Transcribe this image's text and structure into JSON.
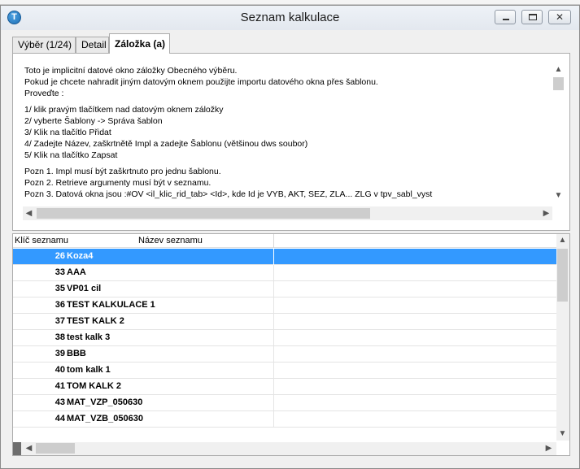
{
  "window": {
    "title": "Seznam kalkulace",
    "icon": "app-t-icon"
  },
  "tabs": [
    {
      "label": "Výběr (1/24)",
      "active": false
    },
    {
      "label": "Detail",
      "active": false
    },
    {
      "label": "Záložka (a)",
      "active": true
    }
  ],
  "info_text": {
    "lines": [
      "Toto je implicitní datové okno záložky Obecného výběru.",
      "Pokud je chcete nahradit jiným datovým oknem použijte importu datového okna přes šablonu.",
      "Proveďte :",
      "1/ klik pravým tlačítkem nad datovým oknem záložky",
      "2/ vyberte Šablony -> Správa šablon",
      "3/ Klik na tlačítlo Přidat",
      "4/ Zadejte Název, zaškrtnětě Impl a zadejte Šablonu (většinou dws soubor)",
      "5/ Klik na tlačítko Zapsat",
      "Pozn 1. Impl musí být zaškrtnuto pro jednu šablonu.",
      "Pozn 2. Retrieve argumenty musí být v seznamu.",
      "Pozn 3. Datová okna jsou :#OV <il_klic_rid_tab>  <Id>,  kde Id je VYB, AKT, SEZ, ZLA... ZLG v  tpv_sabl_vyst"
    ]
  },
  "grid": {
    "columns": [
      "Klíč seznamu",
      "Název seznamu"
    ],
    "rows": [
      {
        "key": "26",
        "name": "Koza4",
        "selected": true
      },
      {
        "key": "33",
        "name": "AAA",
        "selected": false
      },
      {
        "key": "35",
        "name": "VP01 cil",
        "selected": false
      },
      {
        "key": "36",
        "name": "TEST KALKULACE 1",
        "selected": false
      },
      {
        "key": "37",
        "name": "TEST KALK 2",
        "selected": false
      },
      {
        "key": "38",
        "name": "test kalk 3",
        "selected": false
      },
      {
        "key": "39",
        "name": "BBB",
        "selected": false
      },
      {
        "key": "40",
        "name": "tom kalk 1",
        "selected": false
      },
      {
        "key": "41",
        "name": "TOM KALK 2",
        "selected": false
      },
      {
        "key": "43",
        "name": "MAT_VZP_050630",
        "selected": false
      },
      {
        "key": "44",
        "name": "MAT_VZB_050630",
        "selected": false
      }
    ]
  },
  "colors": {
    "selection": "#3399ff",
    "window_bg": "#f0f0f0"
  }
}
